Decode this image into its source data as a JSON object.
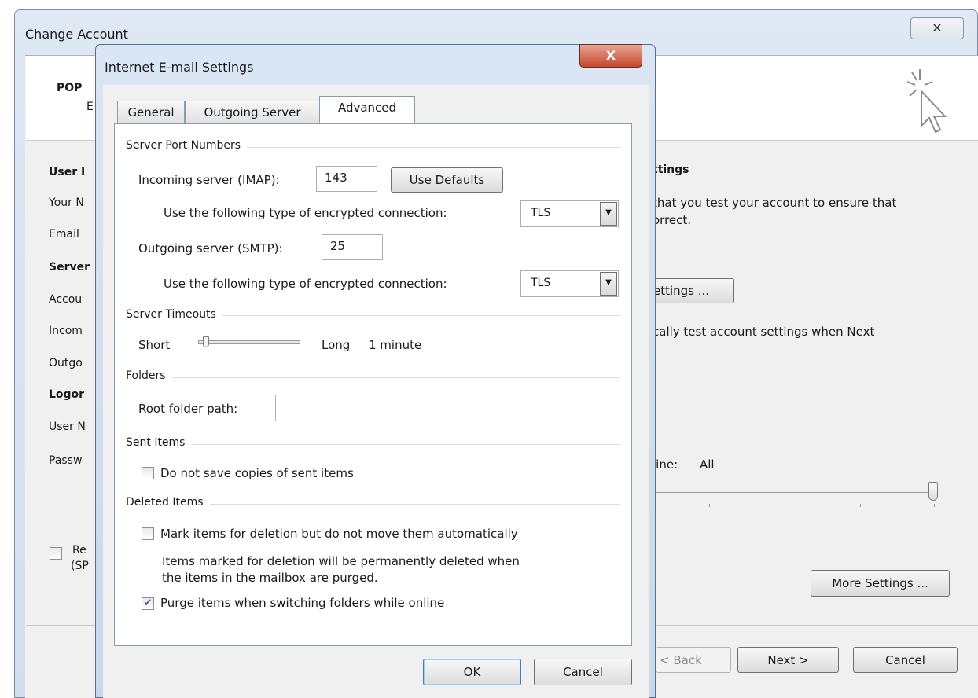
{
  "back_window": {
    "title": "Change Account",
    "close_glyph": "✕",
    "header_title_partial": "POP",
    "header_sub_partial": "E",
    "left_labels": [
      "User I",
      "Your N",
      "Email",
      "Server",
      "Accou",
      "Incom",
      "Outgo",
      "Logor",
      "User N",
      "Passw"
    ],
    "remember_partial_1": "Re",
    "remember_partial_2": "(SP",
    "right_heading_partial": "ttings",
    "right_text_1": "that you test your account to ensure that",
    "right_text_2": "orrect.",
    "test_button_partial": "ettings ...",
    "auto_test_partial": "cally test account settings when Next",
    "offline_label": "line:",
    "offline_value": "All",
    "more_settings": "More Settings ...",
    "back_button": "< Back",
    "next_button": "Next >",
    "cancel_button": "Cancel",
    "offline_slider_level": 1.0
  },
  "dialog": {
    "title": "Internet E-mail Settings",
    "close_glyph": "X",
    "tabs": [
      {
        "label": "General"
      },
      {
        "label": "Outgoing Server"
      },
      {
        "label": "Advanced"
      }
    ],
    "groups": {
      "ports": "Server Port Numbers",
      "timeouts": "Server Timeouts",
      "folders": "Folders",
      "sent": "Sent Items",
      "deleted": "Deleted Items"
    },
    "incoming_label": "Incoming server (IMAP):",
    "incoming_port": "143",
    "use_defaults": "Use Defaults",
    "enc_label_incoming": "Use the following type of encrypted connection:",
    "enc_incoming": "TLS",
    "outgoing_label": "Outgoing server (SMTP):",
    "outgoing_port": "25",
    "enc_label_outgoing": "Use the following type of encrypted connection:",
    "enc_outgoing": "TLS",
    "timeout_short": "Short",
    "timeout_long": "Long",
    "timeout_value": "1 minute",
    "timeout_level": 0.05,
    "root_folder_label": "Root folder path:",
    "root_folder_value": "",
    "sent_checkbox": "Do not save copies of sent items",
    "sent_checked": false,
    "mark_checkbox": "Mark items for deletion but do not move them automatically",
    "mark_checked": false,
    "mark_note_1": "Items marked for deletion will be permanently deleted when",
    "mark_note_2": "the items in the mailbox are purged.",
    "purge_checkbox": "Purge items when switching folders while online",
    "purge_checked": true,
    "ok": "OK",
    "cancel": "Cancel"
  }
}
